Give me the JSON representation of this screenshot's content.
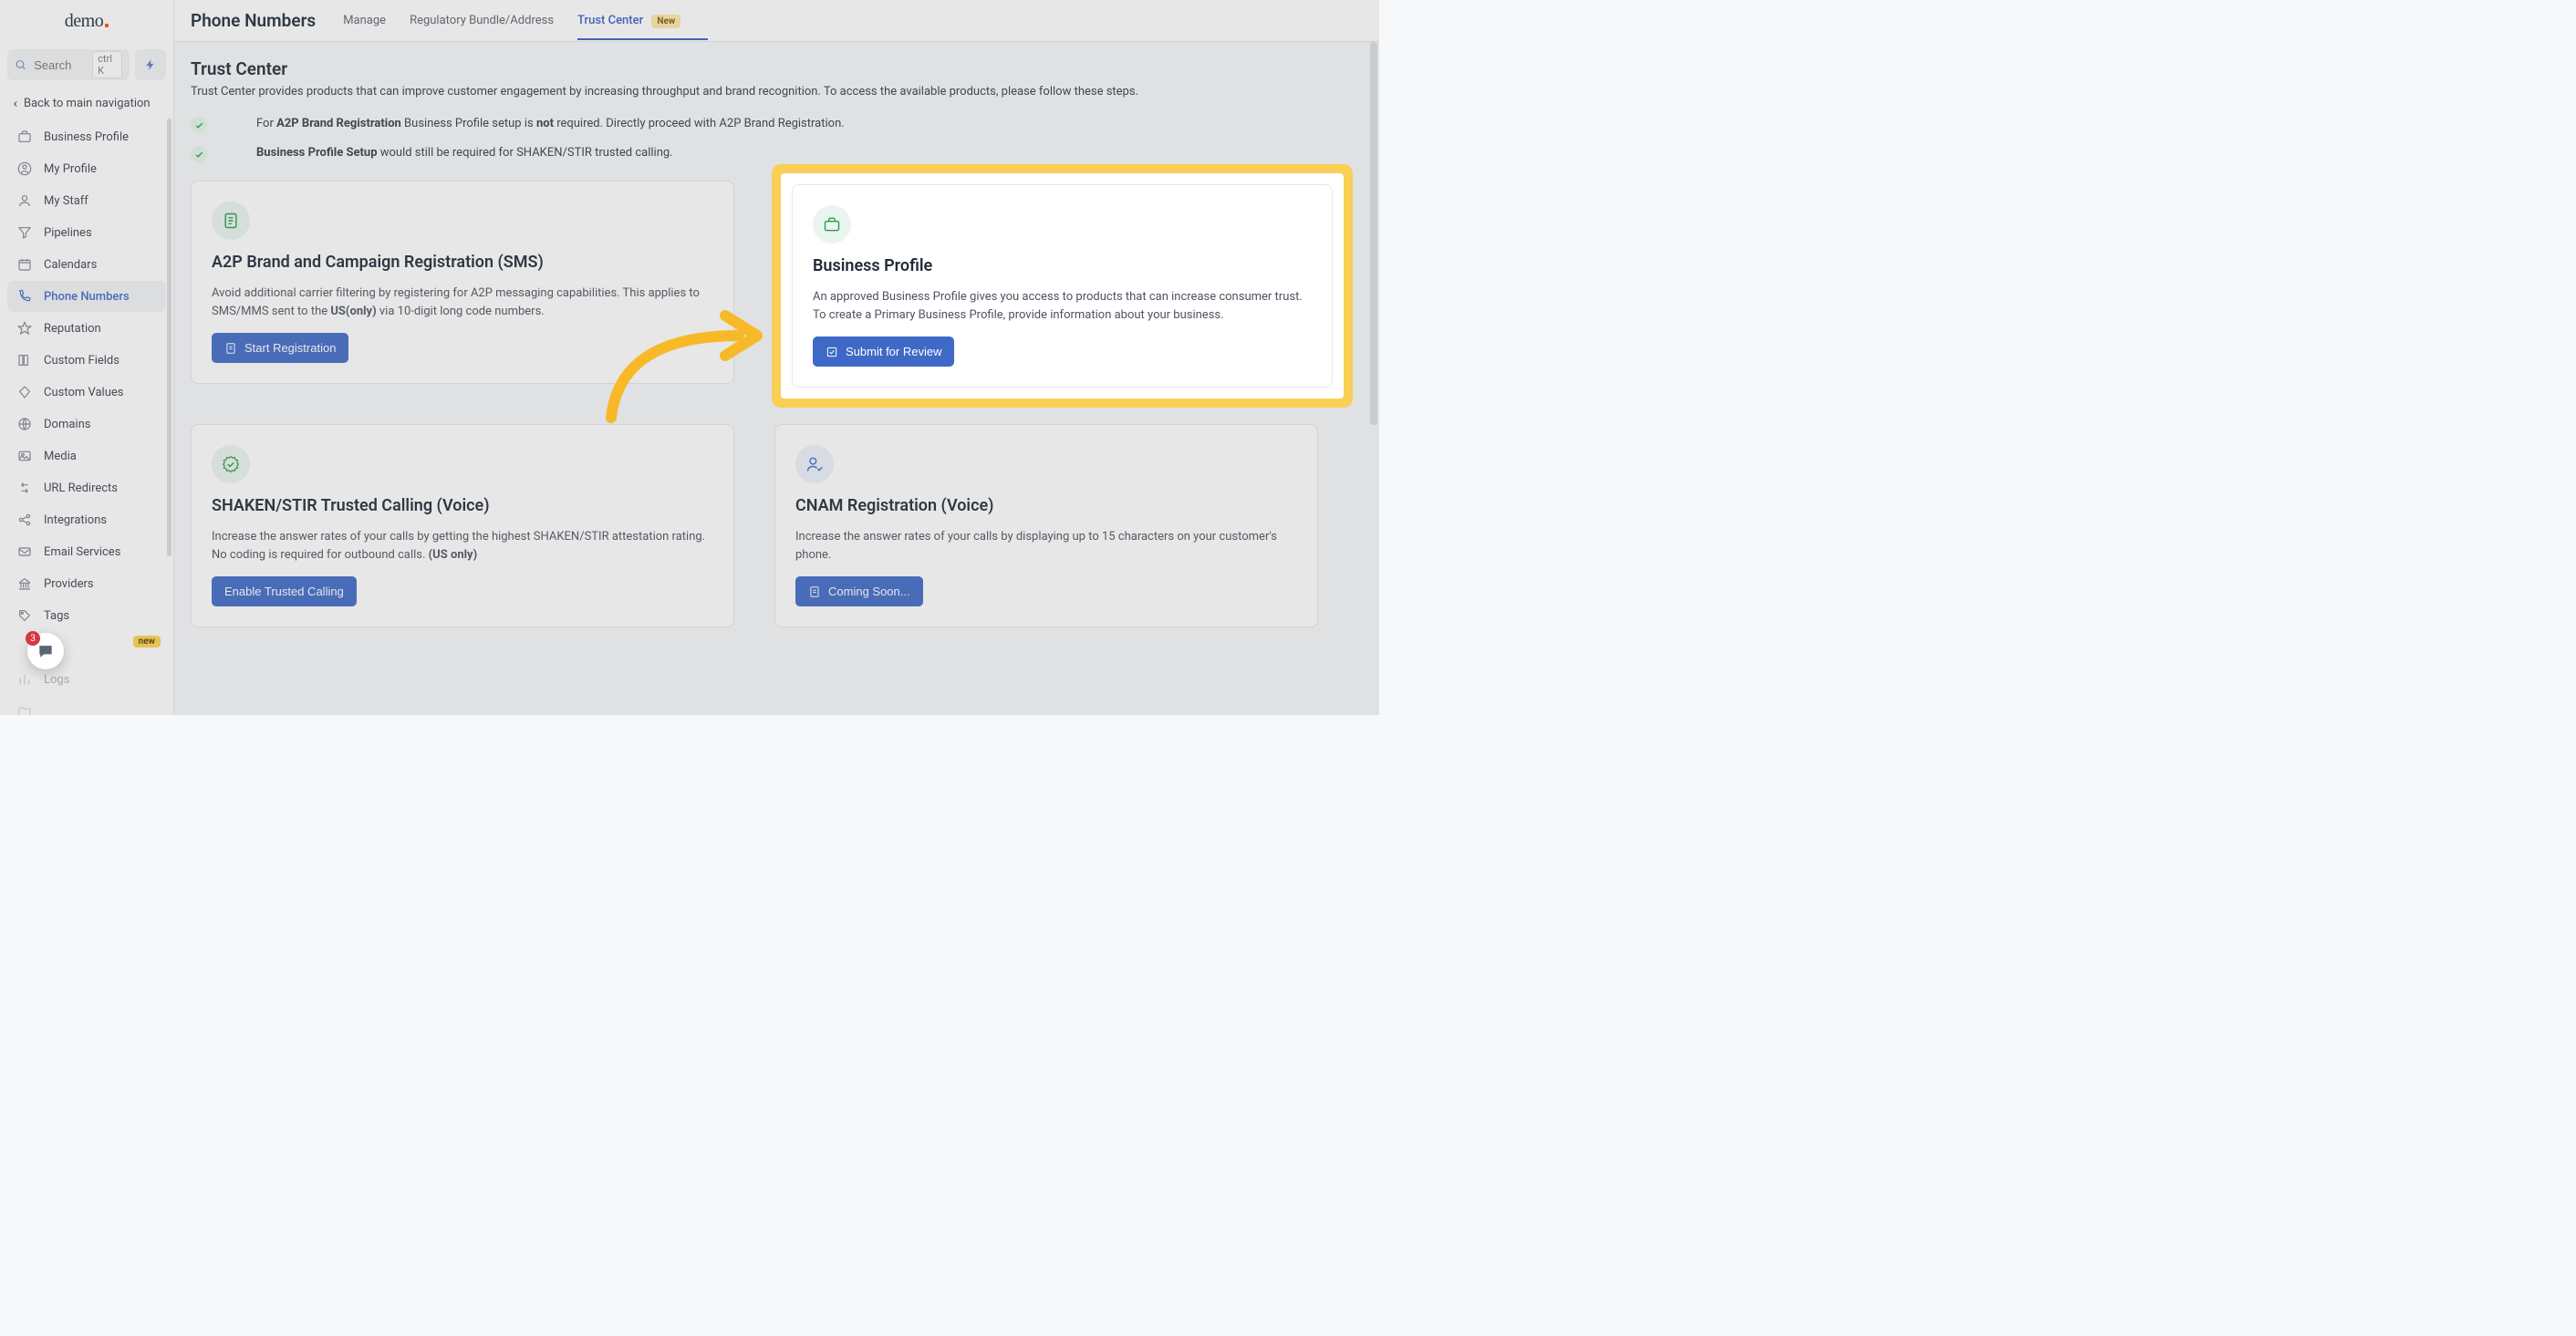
{
  "logo": "demo",
  "search": {
    "placeholder": "Search",
    "shortcut": "ctrl K"
  },
  "back_link": "Back to main navigation",
  "sidebar": {
    "items": [
      {
        "label": "Business Profile",
        "icon": "briefcase"
      },
      {
        "label": "My Profile",
        "icon": "user-circle"
      },
      {
        "label": "My Staff",
        "icon": "user"
      },
      {
        "label": "Pipelines",
        "icon": "funnel"
      },
      {
        "label": "Calendars",
        "icon": "calendar"
      },
      {
        "label": "Phone Numbers",
        "icon": "phone"
      },
      {
        "label": "Reputation",
        "icon": "star"
      },
      {
        "label": "Custom Fields",
        "icon": "columns"
      },
      {
        "label": "Custom Values",
        "icon": "diamond"
      },
      {
        "label": "Domains",
        "icon": "globe-grid"
      },
      {
        "label": "Media",
        "icon": "image"
      },
      {
        "label": "URL Redirects",
        "icon": "arrows"
      },
      {
        "label": "Integrations",
        "icon": "share"
      },
      {
        "label": "Email Services",
        "icon": "mail"
      },
      {
        "label": "Providers",
        "icon": "bank"
      },
      {
        "label": "Tags",
        "icon": "tag"
      },
      {
        "label": "",
        "icon": "",
        "badge": "new"
      },
      {
        "label": "Logs",
        "icon": "bar-chart"
      },
      {
        "label": "",
        "icon": "folder"
      }
    ]
  },
  "chat_count": "3",
  "header": {
    "title": "Phone Numbers",
    "tabs": [
      {
        "label": "Manage"
      },
      {
        "label": "Regulatory Bundle/Address"
      },
      {
        "label": "Trust Center",
        "badge": "New"
      }
    ]
  },
  "trust": {
    "title": "Trust Center",
    "desc": "Trust Center provides products that can improve customer engagement by increasing throughput and brand recognition. To access the available products, please follow these steps.",
    "rows": [
      {
        "pre": "For ",
        "bold1": "A2P Brand Registration",
        "mid1": " Business Profile setup is ",
        "bold2": "not",
        "mid2": " required. Directly proceed with A2P Brand Registration."
      },
      {
        "pre": "",
        "bold1": "Business Profile Setup",
        "mid1": " would still be required for SHAKEN/STIR trusted calling.",
        "bold2": "",
        "mid2": ""
      }
    ]
  },
  "cards": {
    "a2p": {
      "title": "A2P Brand and Campaign Registration (SMS)",
      "desc_pre": "Avoid additional carrier filtering by registering for A2P messaging capabilities. This applies to SMS/MMS sent to the ",
      "desc_bold": "US(only)",
      "desc_post": " via 10-digit long code numbers.",
      "button": "Start Registration"
    },
    "bp": {
      "title": "Business Profile",
      "desc": "An approved Business Profile gives you access to products that can increase consumer trust. To create a Primary Business Profile, provide information about your business.",
      "button": "Submit for Review"
    },
    "shaken": {
      "title": "SHAKEN/STIR Trusted Calling (Voice)",
      "desc_pre": "Increase the answer rates of your calls by getting the highest SHAKEN/STIR attestation rating. No coding is required for outbound calls. ",
      "desc_bold": "(US only)",
      "button": "Enable Trusted Calling"
    },
    "cnam": {
      "title": "CNAM Registration (Voice)",
      "desc": "Increase the answer rates of your calls by displaying up to 15 characters on your customer's phone.",
      "button": "Coming Soon..."
    }
  }
}
